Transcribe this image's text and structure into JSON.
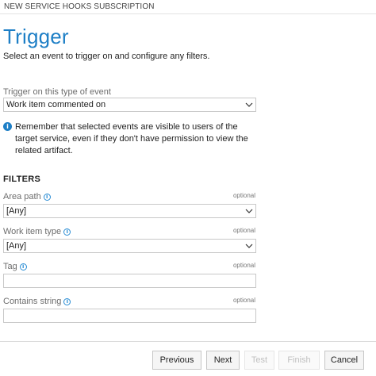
{
  "window": {
    "title": "NEW SERVICE HOOKS SUBSCRIPTION"
  },
  "page": {
    "title": "Trigger",
    "subtitle": "Select an event to trigger on and configure any filters."
  },
  "trigger": {
    "label": "Trigger on this type of event",
    "value": "Work item commented on"
  },
  "notice": {
    "icon": "info-icon",
    "text": "Remember that selected events are visible to users of the target service, even if they don't have permission to view the related artifact."
  },
  "filters": {
    "heading": "FILTERS",
    "optional_label": "optional",
    "area_path": {
      "label": "Area path",
      "value": "[Any]"
    },
    "work_item_type": {
      "label": "Work item type",
      "value": "[Any]"
    },
    "tag": {
      "label": "Tag",
      "value": ""
    },
    "contains_string": {
      "label": "Contains string",
      "value": ""
    }
  },
  "footer": {
    "previous": "Previous",
    "next": "Next",
    "test": "Test",
    "finish": "Finish",
    "cancel": "Cancel"
  },
  "colors": {
    "accent": "#1e7fc6",
    "disabled_text": "#c0c0c0"
  }
}
